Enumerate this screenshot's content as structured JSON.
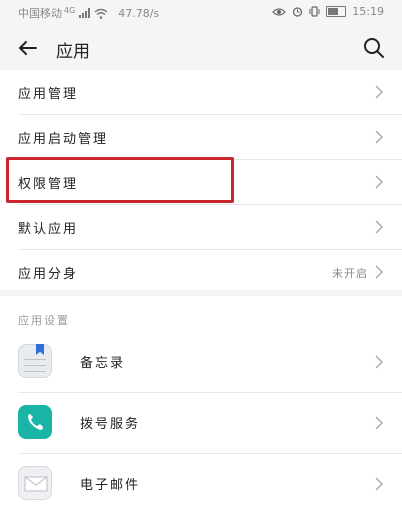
{
  "status_bar": {
    "carrier": "中国移动",
    "network": "4G",
    "speed": "47.78/s",
    "time": "15:19"
  },
  "header": {
    "title": "应用"
  },
  "menu": [
    {
      "label": "应用管理"
    },
    {
      "label": "应用启动管理"
    },
    {
      "label": "权限管理"
    },
    {
      "label": "默认应用"
    },
    {
      "label": "应用分身",
      "value": "未开启"
    }
  ],
  "app_settings": {
    "section_title": "应用设置",
    "items": [
      {
        "label": "备忘录",
        "icon": "memo-icon"
      },
      {
        "label": "拨号服务",
        "icon": "phone-icon"
      },
      {
        "label": "电子邮件",
        "icon": "mail-icon"
      }
    ]
  },
  "colors": {
    "highlight": "#c8262c",
    "phone_icon": "#1bb5a7",
    "memo_bookmark": "#2f6fd6"
  }
}
